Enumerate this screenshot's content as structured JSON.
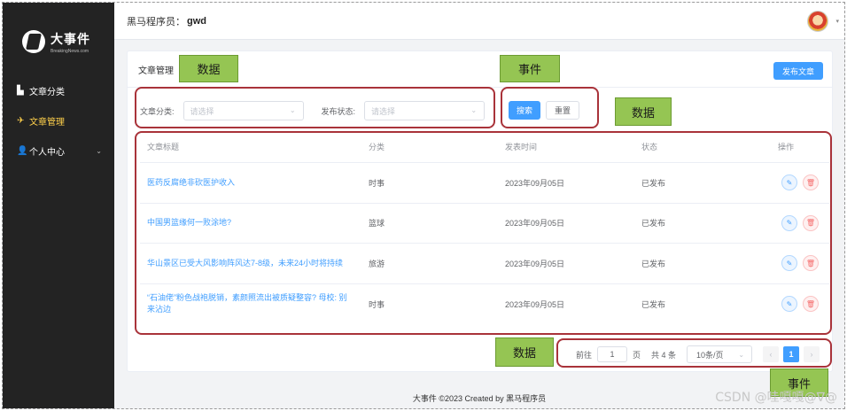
{
  "sidebar": {
    "logo_title": "大事件",
    "logo_sub": "BreakingNews.com",
    "items": [
      {
        "icon": "▙",
        "label": "文章分类",
        "active": false
      },
      {
        "icon": "✈",
        "label": "文章管理",
        "active": true
      },
      {
        "icon": "👤",
        "label": "个人中心",
        "active": false,
        "arrow": "⌄"
      }
    ]
  },
  "header": {
    "label": "黑马程序员：",
    "user": "gwd"
  },
  "card": {
    "title": "文章管理",
    "publish_label": "发布文章",
    "filters": {
      "category_label": "文章分类:",
      "category_placeholder": "请选择",
      "state_label": "发布状态:",
      "state_placeholder": "请选择",
      "search_label": "搜索",
      "reset_label": "重置"
    },
    "table": {
      "columns": [
        "文章标题",
        "分类",
        "发表时间",
        "状态",
        "操作"
      ],
      "rows": [
        {
          "title": "医药反腐绝非砍医护收入",
          "category": "时事",
          "date": "2023年09月05日",
          "state": "已发布"
        },
        {
          "title": "中国男篮缘何一败涂地?",
          "category": "篮球",
          "date": "2023年09月05日",
          "state": "已发布"
        },
        {
          "title": "华山景区已受大风影响阵风达7-8级，未来24小时将持续",
          "category": "旅游",
          "date": "2023年09月05日",
          "state": "已发布"
        },
        {
          "title": "“石油佬”粉色战袍脱销，素颜照流出被质疑整容? 母校: 别来沾边",
          "category": "时事",
          "date": "2023年09月05日",
          "state": "已发布"
        }
      ]
    },
    "pagination": {
      "goto_label": "前往",
      "page_value": "1",
      "page_unit": "页",
      "total_label": "共 4 条",
      "size_label": "10条/页",
      "prev": "‹",
      "current": "1",
      "next": "›"
    }
  },
  "footer": "大事件 ©2023 Created by 黑马程序员",
  "annotations": {
    "data1": "数据",
    "event1": "事件",
    "data2": "数据",
    "data3": "数据",
    "event2": "事件"
  },
  "watermark": "CSDN @哇嘎嘎@∇@",
  "colors": {
    "primary": "#409eff",
    "danger": "#f56c6c",
    "sidebar": "#232323",
    "active": "#ffd04b",
    "annotation_border": "#a9333a",
    "annotation_tag": "#95c553"
  }
}
